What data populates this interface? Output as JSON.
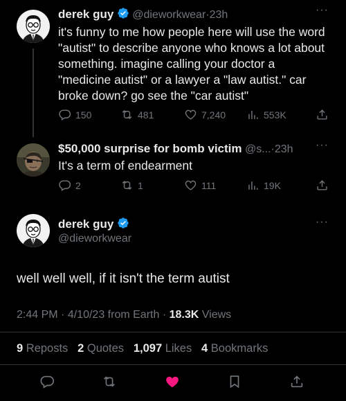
{
  "tweet1": {
    "name": "derek guy",
    "handle": "@dieworkwear",
    "sep": "·",
    "time": "23h",
    "text_lines": [
      "it's funny to me how people here will use the word",
      "\"autist\" to describe anyone who knows a lot about",
      "something. imagine calling your doctor a",
      "\"medicine autist\" or a lawyer a \"law autist.\" car",
      "broke down? go see the \"car autist\""
    ],
    "replies": "150",
    "reposts": "481",
    "likes": "7,240",
    "views": "553K"
  },
  "tweet2": {
    "name": "$50,000 surprise for bomb victim",
    "handle": "@s...",
    "sep": "·",
    "time": "23h",
    "text": "It's a term of endearment",
    "replies": "2",
    "reposts": "1",
    "likes": "111",
    "views": "19K"
  },
  "main_tweet": {
    "name": "derek guy",
    "handle": "@dieworkwear",
    "text": "well well well, if it isn't the term autist",
    "time": "2:44 PM",
    "sep1": "·",
    "date": "4/10/23",
    "source": "from Earth",
    "sep2": "·",
    "views_count": "18.3K",
    "views_label": "Views",
    "reposts_count": "9",
    "reposts_label": "Reposts",
    "quotes_count": "2",
    "quotes_label": "Quotes",
    "likes_count": "1,097",
    "likes_label": "Likes",
    "bookmarks_count": "4",
    "bookmarks_label": "Bookmarks"
  },
  "colors": {
    "background": "#000000",
    "text": "#e7e9ea",
    "muted": "#71767b",
    "verified": "#1d9bf0",
    "liked": "#f91880"
  },
  "icons": [
    "more-icon",
    "verified-badge-icon",
    "reply-icon",
    "repost-icon",
    "like-icon",
    "views-icon",
    "share-icon",
    "bookmark-icon"
  ]
}
